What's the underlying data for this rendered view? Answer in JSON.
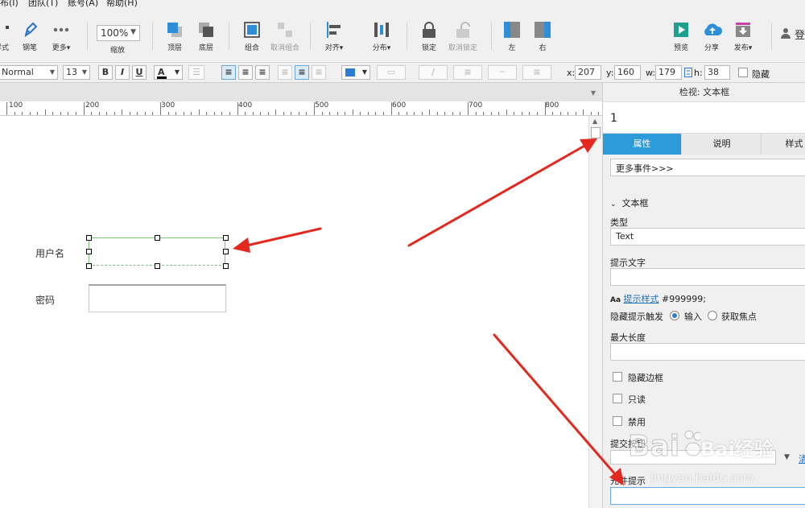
{
  "menubar": {
    "items": [
      "布(I)",
      "团队(T)",
      "账号(A)",
      "帮助(H)"
    ]
  },
  "toolbar": {
    "style_label": "样式",
    "pen_label": "钢笔",
    "more_label": "更多▾",
    "zoom_value": "100%",
    "zoom_label": "缩放",
    "top_label": "顶层",
    "bottom_label": "底层",
    "group_label": "组合",
    "ungroup_label": "取消组合",
    "align_label": "对齐▾",
    "distribute_label": "分布▾",
    "lock_label": "锁定",
    "unlock_label": "取消锁定",
    "left_label": "左",
    "right_label": "右",
    "preview_label": "预览",
    "share_label": "分享",
    "publish_label": "发布▾",
    "login_label": "登"
  },
  "formatbar": {
    "style_value": "Normal",
    "font_size": "13",
    "x_label": "x:",
    "x_value": "207",
    "y_label": "y:",
    "y_value": "160",
    "w_label": "w:",
    "w_value": "179",
    "h_label": "h:",
    "h_value": "38",
    "hide_label": "隐藏"
  },
  "ruler": {
    "labels": [
      "100",
      "200",
      "300",
      "400",
      "500",
      "600",
      "700",
      "800"
    ]
  },
  "canvas": {
    "username_label": "用户名",
    "password_label": "密码"
  },
  "inspector": {
    "title": "检视: 文本框",
    "widget_name": "1",
    "tabs": [
      "属性",
      "说明",
      "样式"
    ],
    "more_events": "更多事件>>>",
    "section_title": "文本框",
    "type_label": "类型",
    "type_value": "Text",
    "hint_text_label": "提示文字",
    "hint_style_link": "提示样式",
    "hint_color": "#999999;",
    "hide_hint_label": "隐藏提示触发",
    "hide_hint_option_input": "输入",
    "hide_hint_option_focus": "获取焦点",
    "max_length_label": "最大长度",
    "hide_border_label": "隐藏边框",
    "readonly_label": "只读",
    "disabled_label": "禁用",
    "submit_button_label": "提交按钮",
    "submit_link": "清",
    "tooltip_label": "元件提示"
  },
  "watermark": {
    "text": "Bai经验",
    "url": "jingyan.baidu.com"
  },
  "colors": {
    "accent": "#2d9ad9",
    "selection_green": "#7cc47c",
    "arrow_red": "#e3281e"
  }
}
